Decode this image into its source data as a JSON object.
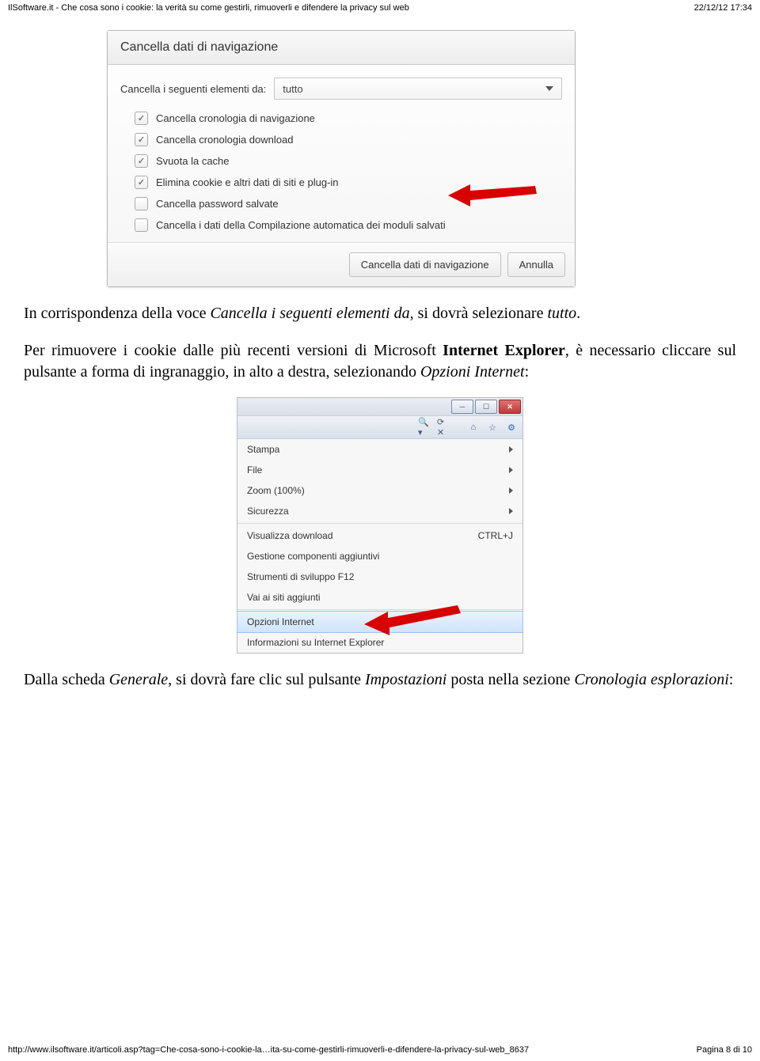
{
  "hdr": {
    "left": "IlSoftware.it - Che cosa sono i cookie: la verità su come gestirli, rimuoverli e difendere la privacy sul web",
    "right": "22/12/12 17:34"
  },
  "dlg": {
    "title": "Cancella dati di navigazione",
    "rowlabel": "Cancella i seguenti elementi da:",
    "select": "tutto",
    "items": [
      {
        "c": true,
        "t": "Cancella cronologia di navigazione"
      },
      {
        "c": true,
        "t": "Cancella cronologia download"
      },
      {
        "c": true,
        "t": "Svuota la cache"
      },
      {
        "c": true,
        "t": "Elimina cookie e altri dati di siti e plug-in"
      },
      {
        "c": false,
        "t": "Cancella password salvate"
      },
      {
        "c": false,
        "t": "Cancella i dati della Compilazione automatica dei moduli salvati"
      }
    ],
    "ok": "Cancella dati di navigazione",
    "cancel": "Annulla"
  },
  "p1": {
    "a": "In corrispondenza della voce ",
    "b": "Cancella i seguenti elementi da",
    "c": ", si dovrà selezionare ",
    "d": "tutto",
    "e": "."
  },
  "p2": {
    "a": "Per rimuovere i cookie dalle più recenti versioni di Microsoft ",
    "b": "Internet Explorer",
    "c": ", è necessario cliccare sul pulsante a forma di ingranaggio, in alto a destra, selezionando ",
    "d": "Opzioni Internet",
    "e": ":"
  },
  "ie": {
    "search": "🔍 ▾",
    "refresh": "⟳ ✕",
    "home": "⌂",
    "star": "☆",
    "gear": "⚙",
    "m": [
      {
        "t": "Stampa",
        "sub": true
      },
      {
        "t": "File",
        "sub": true
      },
      {
        "t": "Zoom (100%)",
        "sub": true
      },
      {
        "t": "Sicurezza",
        "sub": true
      }
    ],
    "m2": [
      {
        "t": "Visualizza download",
        "k": "CTRL+J"
      },
      {
        "t": "Gestione componenti aggiuntivi"
      },
      {
        "t": "Strumenti di sviluppo F12"
      },
      {
        "t": "Vai ai siti aggiunti"
      }
    ],
    "m3": "Opzioni Internet",
    "m4": "Informazioni su Internet Explorer"
  },
  "p3": {
    "a": "Dalla scheda ",
    "b": "Generale",
    "c": ", si dovrà fare clic sul pulsante ",
    "d": "Impostazioni",
    "e": " posta nella sezione ",
    "f": "Cronologia esplorazioni",
    "g": ":"
  },
  "ftr": {
    "left": "http://www.ilsoftware.it/articoli.asp?tag=Che-cosa-sono-i-cookie-la…ita-su-come-gestirli-rimuoverli-e-difendere-la-privacy-sul-web_8637",
    "right": "Pagina 8 di 10"
  }
}
